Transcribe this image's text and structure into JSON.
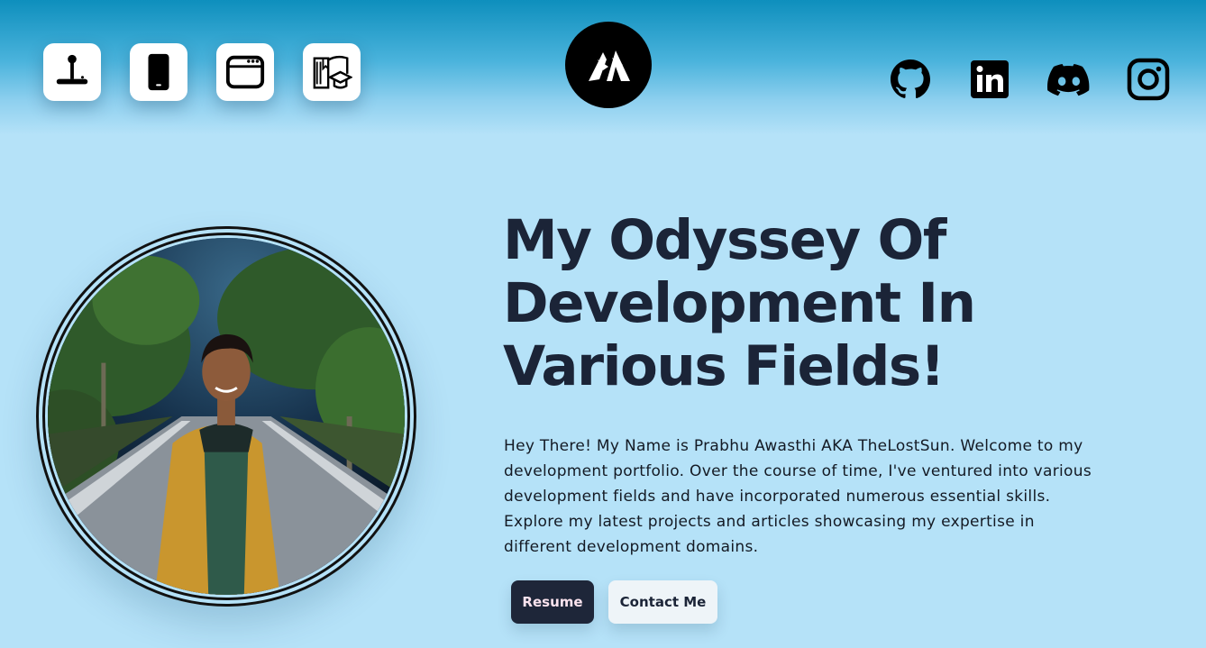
{
  "nav": {
    "items": [
      {
        "icon": "joystick-icon",
        "label": "Game Development"
      },
      {
        "icon": "mobile-icon",
        "label": "App Development"
      },
      {
        "icon": "browser-window-icon",
        "label": "Web Development"
      },
      {
        "icon": "book-graduation-icon",
        "label": "Articles"
      }
    ]
  },
  "logo": {
    "icon": "thelostsun-logo"
  },
  "social": {
    "items": [
      {
        "icon": "github-icon"
      },
      {
        "icon": "linkedin-icon"
      },
      {
        "icon": "discord-icon"
      },
      {
        "icon": "instagram-icon"
      }
    ]
  },
  "hero": {
    "title_line1": "My Odyssey Of",
    "title_line2": "Development In",
    "title_line3": "Various Fields!",
    "intro_line1": "Hey There! My Name is Prabhu Awasthi AKA TheLostSun. Welcome to my",
    "intro_line2": "development portfolio. Over the course of time, I've ventured into various",
    "intro_line3": "development fields and have incorporated numerous essential skills.",
    "intro_line4": "Explore my latest projects and articles showcasing my expertise in",
    "intro_line5": "different development domains.",
    "resume_label": "Resume",
    "contact_label": "Contact Me"
  },
  "colors": {
    "background": "#b5e2f8",
    "header_top": "#0e8fbd",
    "text_dark": "#1b2437",
    "resume_bg": "#1e2639",
    "contact_bg": "#eef4f8"
  }
}
